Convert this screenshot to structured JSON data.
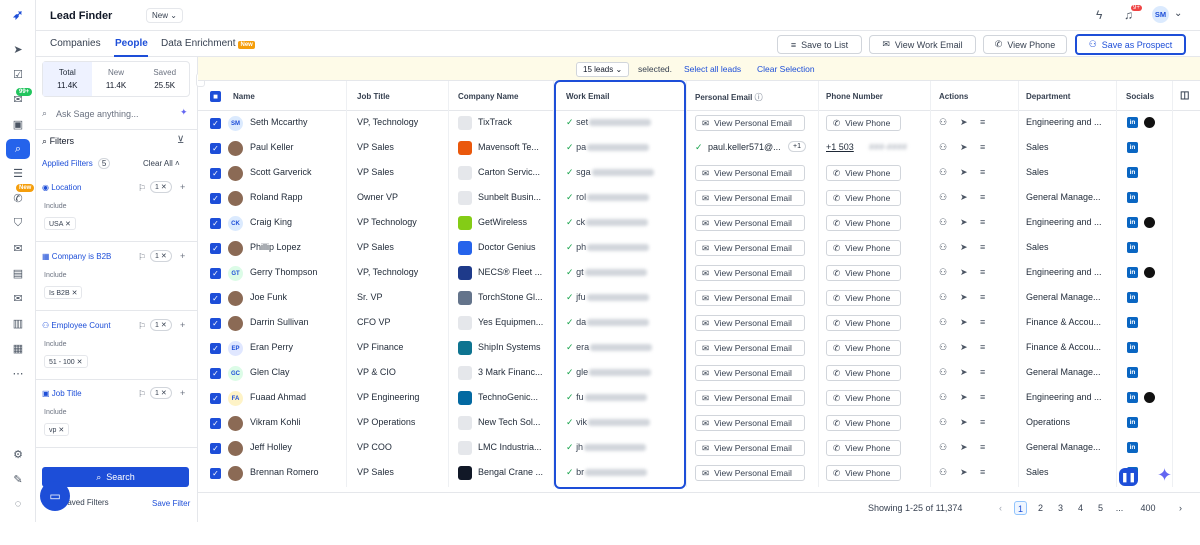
{
  "app": {
    "title": "Lead Finder",
    "version_chip": "New"
  },
  "rail": {
    "badge_messages": "99+",
    "badge_new": "New"
  },
  "header": {
    "notif_count": "9+",
    "avatar": "SM"
  },
  "tabs": [
    {
      "label": "Companies"
    },
    {
      "label": "People"
    },
    {
      "label": "Data Enrichment",
      "tag": "New"
    }
  ],
  "toolbar": {
    "save_to_list": "Save to List",
    "view_work_email": "View Work Email",
    "view_phone": "View Phone",
    "save_as_prospect": "Save as Prospect"
  },
  "counts": {
    "total_label": "Total",
    "total": "11.4K",
    "new_label": "New",
    "new": "11.4K",
    "saved_label": "Saved",
    "saved": "25.5K"
  },
  "sidebar": {
    "sage_placeholder": "Ask Sage anything...",
    "filters": "Filters",
    "applied": "Applied Filters",
    "applied_count": "5",
    "clear_all": "Clear All",
    "include": "Include",
    "filters_list": [
      {
        "label": "Location",
        "count": "1",
        "value": "USA"
      },
      {
        "label": "Company is B2B",
        "count": "1",
        "value": "Is B2B"
      },
      {
        "label": "Employee Count",
        "count": "1",
        "value": "51 - 100"
      },
      {
        "label": "Job Title",
        "count": "1",
        "value": "vp"
      }
    ],
    "search": "Search",
    "saved_filters": "Saved Filters",
    "save_filter": "Save Filter"
  },
  "selection": {
    "leads": "15 leads",
    "selected": "selected.",
    "select_all": "Select all leads",
    "clear": "Clear Selection"
  },
  "columns": {
    "name": "Name",
    "job_title": "Job Title",
    "company": "Company Name",
    "work_email": "Work Email",
    "personal_email": "Personal Email",
    "phone": "Phone Number",
    "actions": "Actions",
    "department": "Department",
    "socials": "Socials"
  },
  "buttons": {
    "view_personal_email": "View Personal Email",
    "view_phone": "View Phone"
  },
  "rows": [
    {
      "name": "Seth Mccarthy",
      "initials": "SM",
      "title": "VP, Technology",
      "company": "TixTrack",
      "email": "set",
      "dept": "Engineering and ...",
      "gh": true,
      "logo": "#e5e7eb"
    },
    {
      "name": "Paul Keller",
      "initials": "",
      "title": "VP Sales",
      "company": "Mavensoft Te...",
      "email": "pa",
      "dept": "Sales",
      "gh": false,
      "logo": "#ea580c",
      "personal": "paul.keller571@...",
      "personal_more": "+1",
      "phone": "+1 503",
      "phone_blur": "###-####"
    },
    {
      "name": "Scott Garverick",
      "initials": "",
      "title": "VP Sales",
      "company": "Carton Servic...",
      "email": "sga",
      "dept": "Sales",
      "gh": false,
      "logo": "#e5e7eb"
    },
    {
      "name": "Roland Rapp",
      "initials": "",
      "title": "Owner VP",
      "company": "Sunbelt Busin...",
      "email": "rol",
      "dept": "General Manage...",
      "gh": false,
      "logo": "#e5e7eb"
    },
    {
      "name": "Craig King",
      "initials": "CK",
      "title": "VP Technology",
      "company": "GetWireless",
      "email": "ck",
      "dept": "Engineering and ...",
      "gh": true,
      "logo": "#84cc16"
    },
    {
      "name": "Phillip Lopez",
      "initials": "",
      "title": "VP Sales",
      "company": "Doctor Genius",
      "email": "ph",
      "dept": "Sales",
      "gh": false,
      "logo": "#2563eb"
    },
    {
      "name": "Gerry Thompson",
      "initials": "GT",
      "title": "VP, Technology",
      "company": "NECS® Fleet ...",
      "email": "gt",
      "dept": "Engineering and ...",
      "gh": true,
      "logo": "#1e3a8a"
    },
    {
      "name": "Joe Funk",
      "initials": "",
      "title": "Sr. VP",
      "company": "TorchStone Gl...",
      "email": "jfu",
      "dept": "General Manage...",
      "gh": false,
      "logo": "#64748b"
    },
    {
      "name": "Darrin Sullivan",
      "initials": "",
      "title": "CFO VP",
      "company": "Yes Equipmen...",
      "email": "da",
      "dept": "Finance & Accou...",
      "gh": false,
      "logo": "#e5e7eb"
    },
    {
      "name": "Eran Perry",
      "initials": "EP",
      "title": "VP Finance",
      "company": "ShipIn Systems",
      "email": "era",
      "dept": "Finance & Accou...",
      "gh": false,
      "logo": "#0e7490"
    },
    {
      "name": "Glen Clay",
      "initials": "GC",
      "title": "VP & CIO",
      "company": "3 Mark Financ...",
      "email": "gle",
      "dept": "General Manage...",
      "gh": false,
      "logo": "#e5e7eb"
    },
    {
      "name": "Fuaad Ahmad",
      "initials": "FA",
      "title": "VP Engineering",
      "company": "TechnoGenic...",
      "email": "fu",
      "dept": "Engineering and ...",
      "gh": true,
      "logo": "#0369a1"
    },
    {
      "name": "Vikram Kohli",
      "initials": "",
      "title": "VP Operations",
      "company": "New Tech Sol...",
      "email": "vik",
      "dept": "Operations",
      "gh": false,
      "logo": "#e5e7eb"
    },
    {
      "name": "Jeff Holley",
      "initials": "",
      "title": "VP COO",
      "company": "LMC Industria...",
      "email": "jh",
      "dept": "General Manage...",
      "gh": false,
      "logo": "#e5e7eb"
    },
    {
      "name": "Brennan Romero",
      "initials": "",
      "title": "VP Sales",
      "company": "Bengal Crane ...",
      "email": "br",
      "dept": "Sales",
      "gh": false,
      "logo": "#111827"
    }
  ],
  "footer": {
    "showing": "Showing",
    "range": "1-25 of 11,374",
    "pages": [
      "1",
      "2",
      "3",
      "4",
      "5",
      "...",
      "400"
    ]
  },
  "colors": {
    "accent": "#1d4ed8",
    "success": "#16a34a",
    "linkedin": "#0a66c2"
  }
}
